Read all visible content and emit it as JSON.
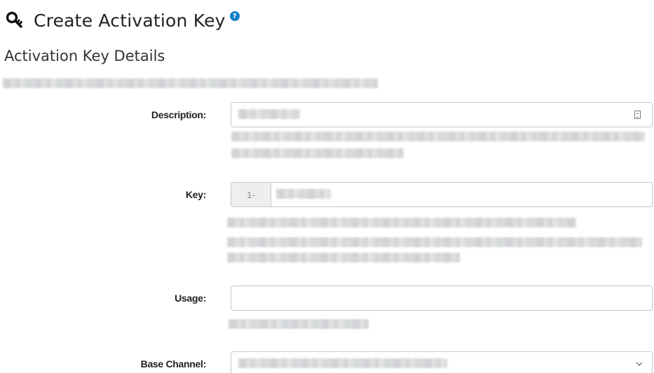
{
  "header": {
    "title": "Create Activation Key",
    "icon": "key-icon",
    "help_icon": "question-circle-icon",
    "help_glyph": "?",
    "accent_color": "#0f7ec8"
  },
  "section": {
    "title": "Activation Key Details"
  },
  "form": {
    "description": {
      "label": "Description:"
    },
    "key": {
      "label": "Key:",
      "prefix": "1-"
    },
    "usage": {
      "label": "Usage:",
      "value": ""
    },
    "base_channel": {
      "label": "Base Channel:"
    }
  }
}
